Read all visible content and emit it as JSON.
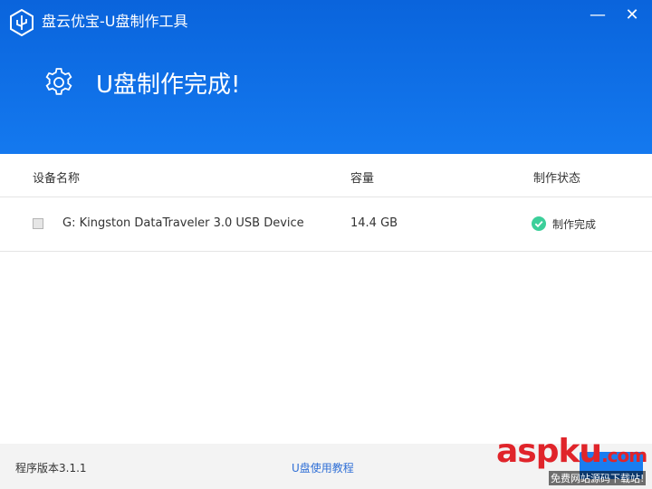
{
  "window": {
    "title": "盘云优宝-U盘制作工具",
    "minimize": "—",
    "close": "✕"
  },
  "hero": {
    "message": "U盘制作完成!"
  },
  "table": {
    "headers": [
      "设备名称",
      "容量",
      "制作状态"
    ],
    "rows": [
      {
        "device": "G: Kingston DataTraveler 3.0 USB Device",
        "capacity": "14.4 GB",
        "status": "制作完成"
      }
    ]
  },
  "footer": {
    "version": "程序版本3.1.1",
    "guide_link": "U盘使用教程"
  },
  "watermark": {
    "brand": "aspku",
    "suffix": ".com",
    "tagline": "免费网站源码下载站!"
  },
  "colors": {
    "header": "#0a64dc",
    "accent": "#1a7df0",
    "success": "#3ccf9a",
    "link": "#2f6fd6",
    "watermark": "#e0242a"
  },
  "icons": {
    "logo": "usb-shield-icon",
    "hero": "gear-icon",
    "status": "check-circle-icon"
  }
}
